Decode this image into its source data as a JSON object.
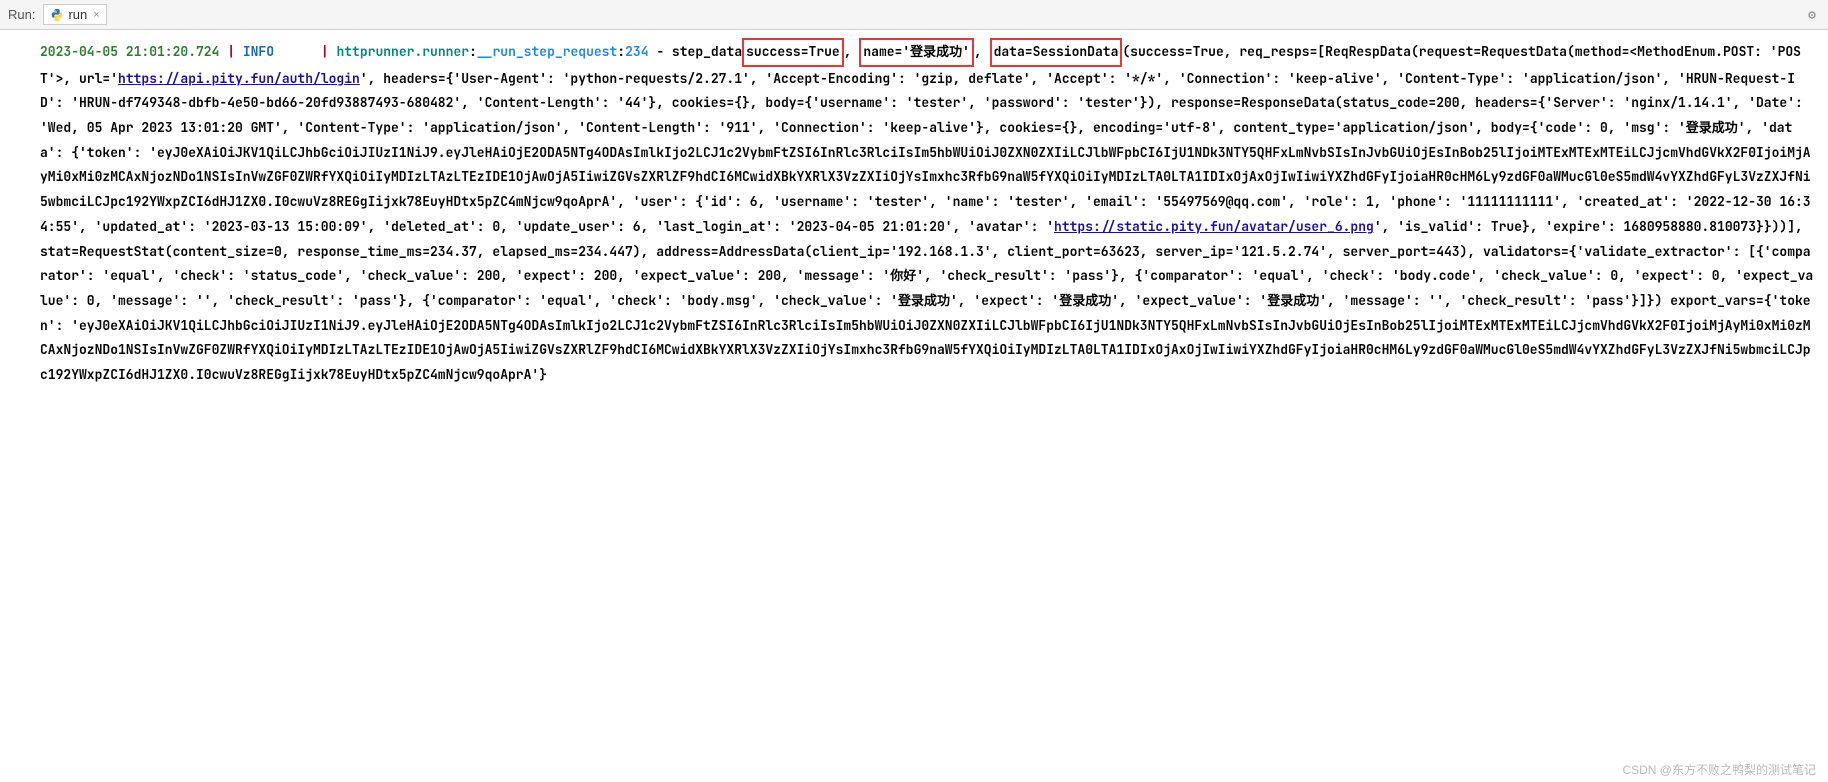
{
  "titlebar": {
    "run_label": "Run:",
    "tab_name": "run",
    "close_x": "×",
    "gear_glyph": "⚙"
  },
  "log": {
    "timestamp": "2023-04-05 21:01:20.724",
    "level": "INFO",
    "module": "httprunner.runner",
    "func": "__run_step_request",
    "lineno": "234",
    "prefix": "step_data",
    "hi1": "success=True",
    "mid1": ", ",
    "hi2": "name='登录成功'",
    "mid2": ", ",
    "hi3": "data=SessionData",
    "after_hi": "(success=True, req_resps=[ReqRespData(request=RequestData(method=<MethodEnum.POST: 'POST'>, url='",
    "url1": "https://api.pity.fun/auth/login",
    "body1": "', headers={'User-Agent': 'python-requests/2.27.1', 'Accept-Encoding': 'gzip, deflate', 'Accept': '*/*', 'Connection': 'keep-alive', 'Content-Type': 'application/json', 'HRUN-Request-ID': 'HRUN-df749348-dbfb-4e50-bd66-20fd93887493-680482', 'Content-Length': '44'}, cookies={}, body={'username': 'tester', 'password': 'tester'}), response=ResponseData(status_code=200, headers={'Server': 'nginx/1.14.1', 'Date': 'Wed, 05 Apr 2023 13:01:20 GMT', 'Content-Type': 'application/json', 'Content-Length': '911', 'Connection': 'keep-alive'}, cookies={}, encoding='utf-8', content_type='application/json', body={'code': 0, 'msg': '登录成功', 'data': {'token': 'eyJ0eXAiOiJKV1QiLCJhbGciOiJIUzI1NiJ9.eyJleHAiOjE2ODA5NTg4ODAsImlkIjo2LCJ1c2VybmFtZSI6InRlc3RlciIsIm5hbWUiOiJ0ZXN0ZXIiLCJlbWFpbCI6IjU1NDk3NTY5QHFxLmNvbSIsInJvbGUiOjEsInBob25lIjoiMTExMTExMTEiLCJjcmVhdGVkX2F0IjoiMjAyMi0xMi0zMCAxNjozNDo1NSIsInVwZGF0ZWRfYXQiOiIyMDIzLTAzLTEzIDE1OjAwOjA5IiwiZGVsZXRlZF9hdCI6MCwidXBkYXRlX3VzZXIiOjYsImxhc3RfbG9naW5fYXQiOiIyMDIzLTA0LTA1IDIxOjAxOjIwIiwiYXZhdGFyIjoiaHR0cHM6Ly9zdGF0aWMucGl0eS5mdW4vYXZhdGFyL3VzZXJfNi5wbmciLCJpc192YWxpZCI6dHJ1ZX0.I0cwuVz8REGgIijxk78EuyHDtx5pZC4mNjcw9qoAprA', 'user': {'id': 6, 'username': 'tester', 'name': 'tester', 'email': '55497569@qq.com', 'role': 1, 'phone': '11111111111', 'created_at': '2022-12-30 16:34:55', 'updated_at': '2023-03-13 15:00:09', 'deleted_at': 0, 'update_user': 6, 'last_login_at': '2023-04-05 21:01:20', 'avatar': '",
    "url2": "https://static.pity.fun/avatar/user_6.png",
    "body2": "', 'is_valid': True}, 'expire': 1680958880.810073}}))], stat=RequestStat(content_size=0, response_time_ms=234.37, elapsed_ms=234.447), address=AddressData(client_ip='192.168.1.3', client_port=63623, server_ip='121.5.2.74', server_port=443), validators={'validate_extractor': [{'comparator': 'equal', 'check': 'status_code', 'check_value': 200, 'expect': 200, 'expect_value': 200, 'message': '你好', 'check_result': 'pass'}, {'comparator': 'equal', 'check': 'body.code', 'check_value': 0, 'expect': 0, 'expect_value': 0, 'message': '', 'check_result': 'pass'}, {'comparator': 'equal', 'check': 'body.msg', 'check_value': '登录成功', 'expect': '登录成功', 'expect_value': '登录成功', 'message': '', 'check_result': 'pass'}]}) export_vars={'token': 'eyJ0eXAiOiJKV1QiLCJhbGciOiJIUzI1NiJ9.eyJleHAiOjE2ODA5NTg4ODAsImlkIjo2LCJ1c2VybmFtZSI6InRlc3RlciIsIm5hbWUiOiJ0ZXN0ZXIiLCJlbWFpbCI6IjU1NDk3NTY5QHFxLmNvbSIsInJvbGUiOjEsInBob25lIjoiMTExMTExMTEiLCJjcmVhdGVkX2F0IjoiMjAyMi0xMi0zMCAxNjozNDo1NSIsInVwZGF0ZWRfYXQiOiIyMDIzLTAzLTEzIDE1OjAwOjA5IiwiZGVsZXRlZF9hdCI6MCwidXBkYXRlX3VzZXIiOjYsImxhc3RfbG9naW5fYXQiOiIyMDIzLTA0LTA1IDIxOjAxOjIwIiwiYXZhdGFyIjoiaHR0cHM6Ly9zdGF0aWMucGl0eS5mdW4vYXZhdGFyL3VzZXJfNi5wbmciLCJpc192YWxpZCI6dHJ1ZX0.I0cwuVz8REGgIijxk78EuyHDtx5pZC4mNjcw9qoAprA'}"
  },
  "watermark": "CSDN @东方不败之鸭梨的测试笔记"
}
